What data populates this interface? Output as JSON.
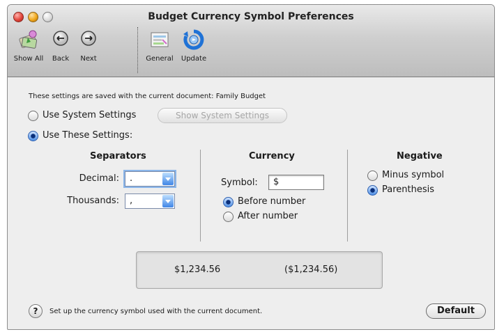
{
  "window": {
    "title": "Budget Currency Symbol Preferences"
  },
  "toolbar": {
    "show_all": "Show All",
    "back": "Back",
    "next": "Next",
    "general": "General",
    "update": "Update"
  },
  "info": {
    "saved_with_label": "These settings are saved with the current document:",
    "document_name": "Family Budget"
  },
  "settings_mode": {
    "use_system": "Use System Settings",
    "show_system_button": "Show System Settings",
    "use_these": "Use These Settings:",
    "selected": "Use These Settings:"
  },
  "separators": {
    "heading": "Separators",
    "decimal_label": "Decimal:",
    "decimal_value": ".",
    "thousands_label": "Thousands:",
    "thousands_value": ","
  },
  "currency": {
    "heading": "Currency",
    "symbol_label": "Symbol:",
    "symbol_value": "$",
    "before_number": "Before number",
    "after_number": "After number",
    "selected": "Before number"
  },
  "negative": {
    "heading": "Negative",
    "minus_symbol": "Minus symbol",
    "parenthesis": "Parenthesis",
    "selected": "Parenthesis"
  },
  "preview": {
    "positive": "$1,234.56",
    "negative": "($1,234.56)"
  },
  "footer": {
    "help_glyph": "?",
    "help_text": "Set up the currency symbol used with the current document.",
    "default_button": "Default"
  },
  "icons": [
    "show-all-icon",
    "back-icon",
    "next-icon",
    "general-icon",
    "update-icon",
    "help-icon",
    "popup-arrow-icon"
  ],
  "colors": {
    "accent": "#3f86e6",
    "selected_radio": "#4f8fe4",
    "chrome_top": "#e9e9e9",
    "chrome_bottom": "#bdbdbd"
  }
}
